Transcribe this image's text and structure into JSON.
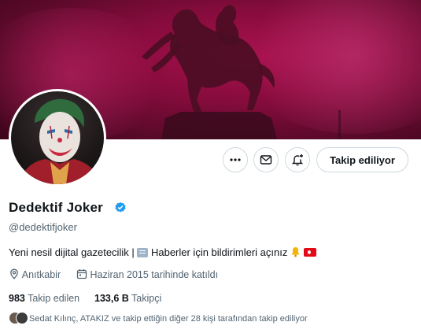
{
  "profile": {
    "display_name": "Dedektif Joker",
    "handle": "@dedektifjoker",
    "bio_part1": "Yeni nesil dijital gazetecilik |",
    "bio_part2": "Haberler için bildirimleri açınız",
    "location": "Anıtkabir",
    "joined": "Haziran 2015 tarihinde katıldı",
    "following_count": "983",
    "following_label": "Takip edilen",
    "followers_count": "133,6 B",
    "followers_label": "Takipçi",
    "followed_by": "Sedat Kılınç, ATAKIZ ve takip ettiğin diğer 28 kişi tarafından takip ediliyor"
  },
  "actions": {
    "follow_label": "Takip ediliyor"
  },
  "icons": {
    "more": "more-icon",
    "message": "mail-icon",
    "notify": "bell-plus-icon",
    "location": "location-pin-icon",
    "calendar": "calendar-icon",
    "verified": "verified-badge-icon",
    "bio_newspaper": "newspaper-icon",
    "bio_bell": "bell-icon",
    "bio_flag": "turkey-flag-icon"
  },
  "colors": {
    "banner": "#8a0c3e",
    "verified": "#1d9bf0",
    "secondary_text": "#536471"
  }
}
